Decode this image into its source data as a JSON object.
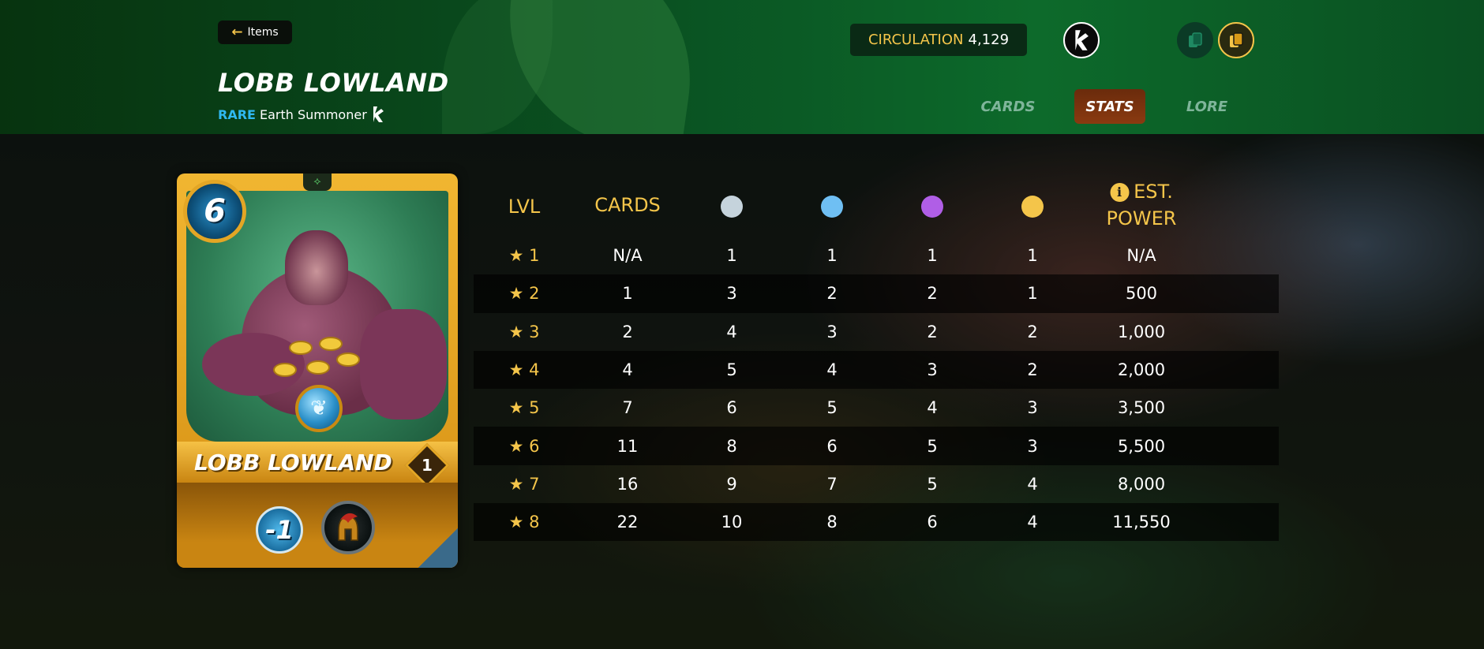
{
  "header": {
    "back_label": "Items",
    "card_title": "LOBB LOWLAND",
    "rarity": "RARE",
    "type": "Earth Summoner",
    "circulation_label": "CIRCULATION",
    "circulation_value": "4,129",
    "tabs": [
      {
        "label": "CARDS",
        "active": false
      },
      {
        "label": "STATS",
        "active": true
      },
      {
        "label": "LORE",
        "active": false
      }
    ]
  },
  "card": {
    "name": "LOBB LOWLAND",
    "mana": "6",
    "level": "1",
    "buff": "-1",
    "element": "earth",
    "ability_icon": "spartan-helmet-icon"
  },
  "stats": {
    "headers": {
      "lvl": "LVL",
      "cards": "CARDS",
      "power_line1": "EST.",
      "power_line2": "POWER"
    },
    "rarity_colors": [
      "#c5d3dc",
      "#6fbff3",
      "#b05ee6",
      "#f4c54a"
    ],
    "rows": [
      {
        "lvl": "★ 1",
        "cards": "N/A",
        "c": "1",
        "r": "1",
        "e": "1",
        "l": "1",
        "power": "N/A"
      },
      {
        "lvl": "★ 2",
        "cards": "1",
        "c": "3",
        "r": "2",
        "e": "2",
        "l": "1",
        "power": "500"
      },
      {
        "lvl": "★ 3",
        "cards": "2",
        "c": "4",
        "r": "3",
        "e": "2",
        "l": "2",
        "power": "1,000"
      },
      {
        "lvl": "★ 4",
        "cards": "4",
        "c": "5",
        "r": "4",
        "e": "3",
        "l": "2",
        "power": "2,000"
      },
      {
        "lvl": "★ 5",
        "cards": "7",
        "c": "6",
        "r": "5",
        "e": "4",
        "l": "3",
        "power": "3,500"
      },
      {
        "lvl": "★ 6",
        "cards": "11",
        "c": "8",
        "r": "6",
        "e": "5",
        "l": "3",
        "power": "5,500"
      },
      {
        "lvl": "★ 7",
        "cards": "16",
        "c": "9",
        "r": "7",
        "e": "5",
        "l": "4",
        "power": "8,000"
      },
      {
        "lvl": "★ 8",
        "cards": "22",
        "c": "10",
        "r": "8",
        "e": "6",
        "l": "4",
        "power": "11,550"
      }
    ]
  }
}
